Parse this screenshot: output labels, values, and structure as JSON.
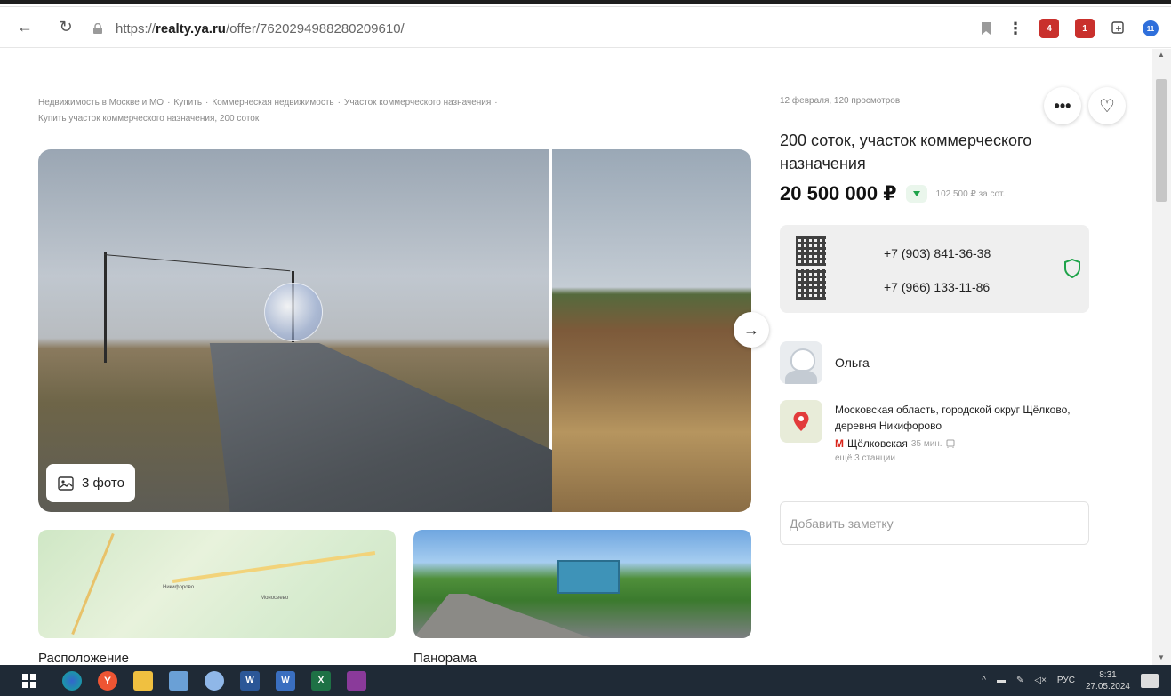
{
  "browser": {
    "url_prefix": "https://",
    "url_domain": "realty.ya.ru",
    "url_path": "/offer/7620294988280209610/",
    "back_label": "←",
    "reload_label": "↻",
    "more_label": "⋮",
    "ext_badge_1": "4",
    "ext_badge_2": "1",
    "download_badge": "11"
  },
  "breadcrumb": {
    "items": [
      "Недвижимость в Москве и МО",
      "Купить",
      "Коммерческая недвижимость",
      "Участок коммерческого назначения"
    ],
    "current": "Купить участок коммерческого назначения, 200 соток",
    "separator": "·"
  },
  "gallery": {
    "photo_count_label": "3 фото",
    "next_label": "→"
  },
  "thumbs": {
    "map_caption": "Расположение",
    "pano_caption": "Панорама",
    "map_label_1": "Никифорово",
    "map_label_2": "Моносеево"
  },
  "offer": {
    "date_views": "12 февраля, 120 просмотров",
    "more_label": "•••",
    "fav_label": "♡",
    "title": "200 соток, участок коммерческого назначения",
    "price": "20 500 000 ₽",
    "price_per": "102 500 ₽ за сот."
  },
  "contacts": {
    "phone_1": "+7 (903) 841-36-38",
    "phone_2": "+7 (966) 133-11-86"
  },
  "seller": {
    "name": "Ольга"
  },
  "location": {
    "address": "Московская область, городской округ Щёлково, деревня Никифорово",
    "metro_letter": "М",
    "metro_name": "Щёлковская",
    "metro_time": "35 мин.",
    "more_stations": "ещё 3 станции"
  },
  "note": {
    "placeholder": "Добавить заметку"
  },
  "taskbar": {
    "lang": "РУС",
    "time": "8:31",
    "date": "27.05.2024"
  },
  "colors": {
    "accent_green": "#1fa34a",
    "metro_red": "#d9261c",
    "taskbar_bg": "#1f2a36"
  }
}
